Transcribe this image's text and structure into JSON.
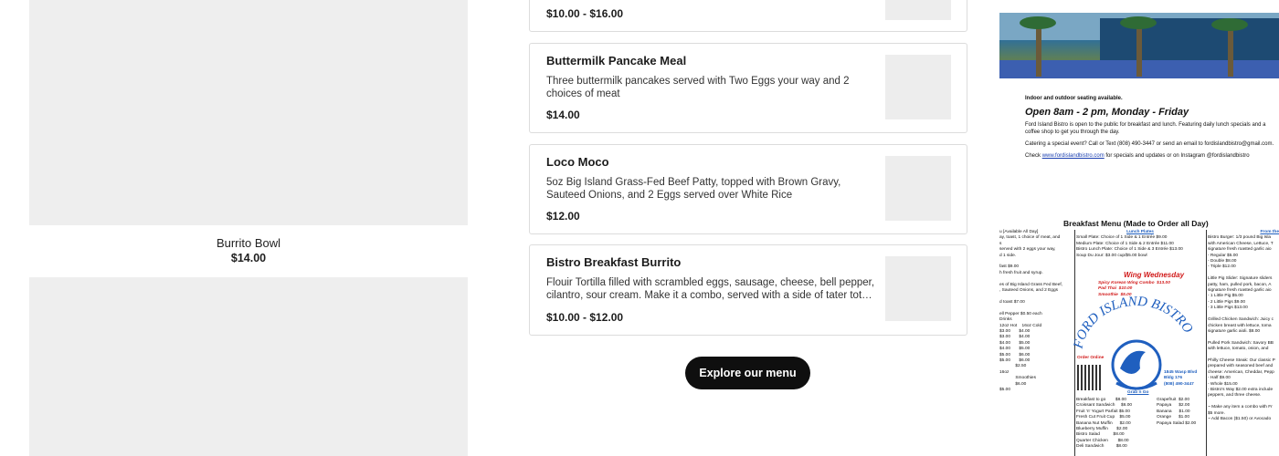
{
  "left_items": [
    {
      "name": "Burrito Bowl",
      "price": "$14.00"
    }
  ],
  "menu_cards": [
    {
      "title": "",
      "description": "",
      "price": "$10.00 - $16.00"
    },
    {
      "title": "Buttermilk Pancake Meal",
      "description": "Three buttermilk pancakes served with Two Eggs your way and 2 choices of meat",
      "price": "$14.00"
    },
    {
      "title": "Loco Moco",
      "description": "5oz Big Island Grass-Fed Beef Patty, topped with Brown Gravy, Sauteed Onions, and 2 Eggs served over White Rice",
      "price": "$12.00"
    },
    {
      "title": "Bistro Breakfast Burrito",
      "description": "Flouir Tortilla filled with scrambled eggs, sausage, cheese, bell pepper, cilantro, sour cream. Make it a combo, served with a side of tater tots $2...",
      "price": "$10.00 - $12.00"
    }
  ],
  "explore_button": "Explore our menu",
  "flyer": {
    "seating": "Indoor and outdoor seating available.",
    "hours": "Open 8am - 2 pm, Monday - Friday",
    "para1": "Ford Island Bistro is open to the public for breakfast and lunch. Featuring daily lunch specials and a coffee shop to get you through the day.",
    "para2": "Catering a special event? Call or Text (808) 490-3447 or send an email to fordislandbistro@gmail.com.",
    "para3_pre": "Check ",
    "para3_link": "www.fordislandbistro.com",
    "para3_post": " for specials and updates or on Instagram @fordislandbistro"
  },
  "menu_image": {
    "title": "Breakfast Menu (Made to Order all Day)",
    "col_left": [
      "u [Available All Day]",
      "ay, toast, 1 choice of meat, and",
      "s",
      "served with 2 eggs your way,",
      "d 1 side.",
      "",
      "fast $9.00",
      "h fresh fruit and syrup.",
      "",
      "es of Big Island Grass Fed Beef,",
      ", Sauteed Onions, and 2 Eggs",
      "",
      "d toast $7.00",
      "",
      "ell Pepper $0.50 each",
      "Drinks",
      "12oz Hot    16oz Cold",
      "$3.00       $4.00",
      "$3.00       $4.00",
      "$4.00       $5.00",
      "$4.00       $5.00",
      "$5.00       $6.00",
      "$5.00       $6.00",
      "             $2.50",
      "16oz",
      "             Smoothies",
      "             $6.00",
      "$5.00"
    ],
    "lunch_header": "Lunch Plates",
    "col_mid": [
      "Small Plate: Choice of 1 Side & 1 Entrée $9.00",
      "Medium Plate: Choice of 1 Side & 2 Entrée $11.00",
      "Bistro Lunch Plate: Choice of 1 Side & 3 Entrée $13.00",
      "Soup Du Jour: $3.00 cup/$5.00 bowl"
    ],
    "wing_title": "Wing Wednesday",
    "wing_lines": [
      "Spicy Korean Wing Combo  $13.00",
      "Pad Thai  $10.00",
      "Smoothie  $5.00"
    ],
    "order_online": "Order Online",
    "address": [
      "1845 Wasp Blvd",
      "Bldg 176",
      "(808) 490-3447"
    ],
    "grab": "Grab n Go",
    "grab_items": [
      "Breakfast to go        $8.00",
      "Croissant Sandwich     $6.00",
      "Fruit 'n' Yogurt Parfait $5.00",
      "Fresh Cut Fruit Cup    $5.00",
      "Banana Nut Muffin      $2.00",
      "Blueberry Muffin       $2.00",
      "Bistro Salad           $8.00",
      "Quarter Chicken        $8.00",
      "Deli Sandwich          $8.00"
    ],
    "fruit_items": [
      "Grapefruit  $2.00",
      "Papaya      $2.00",
      "Banana      $1.00",
      "Orange      $1.00",
      "Papaya Salad $2.00"
    ],
    "col_right_header": "From the",
    "col_right": [
      "Bistro Burger: 1/3 pound Big Isla",
      "with American Cheese, Lettuce, T",
      "signature fresh roasted garlic aio",
      "- Regular $5.00",
      "- Double $8.00",
      "- Triple $12.00",
      "",
      "Little Pig Slider: Signature sliders",
      "patty, ham, pulled pork, bacon, A",
      "signature fresh roasted garlic aio",
      "- 1 Little Pig $5.00",
      "- 2 Little Pigs $9.00",
      "- 3 Little Pigs $13.00",
      "",
      "Grilled Chicken Sandwich: Juicy c",
      "chicken breast with lettuce, toma",
      "signature garlic aioli. $8.00",
      "",
      "Pulled Pork Sandwich: Savory BB",
      "with lettuce, tomato, onion, and",
      "",
      "Philly Cheese Steak: Our classic P",
      "prepared with seasoned beef and",
      "cheese: American, Cheddar, Pepp",
      "- Half $9.00",
      "- Whole $15.00",
      "- Bistro's Way $2.00 extra include",
      "peppers, and three cheese.",
      "",
      "~ Make any item a combo with Fr",
      "$5 more.",
      "~ Add Bacon ($1.50) or Avocado"
    ],
    "logo_text": "FORD ISLAND BISTRO"
  }
}
